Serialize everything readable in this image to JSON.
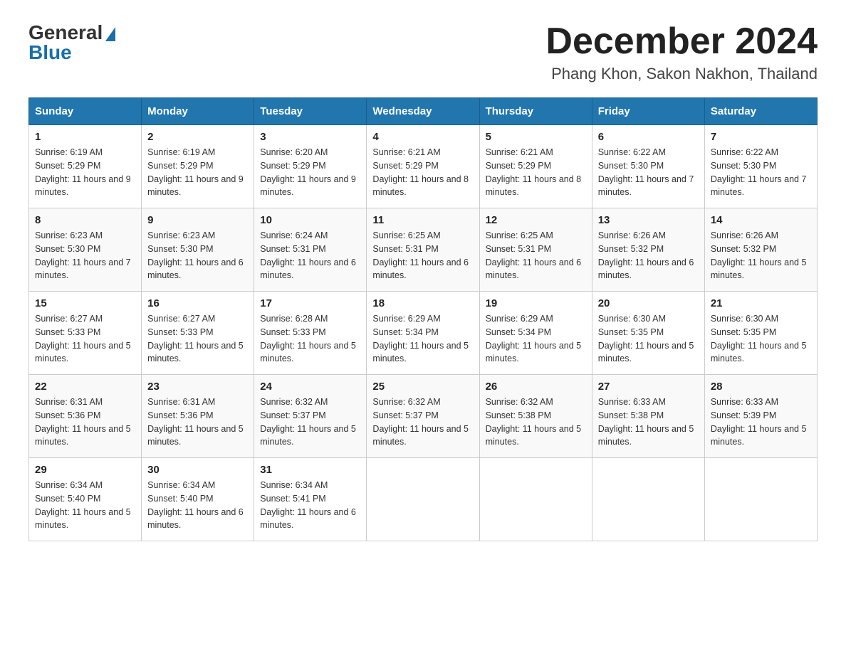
{
  "header": {
    "logo_general": "General",
    "logo_blue": "Blue",
    "month": "December 2024",
    "location": "Phang Khon, Sakon Nakhon, Thailand"
  },
  "days_of_week": [
    "Sunday",
    "Monday",
    "Tuesday",
    "Wednesday",
    "Thursday",
    "Friday",
    "Saturday"
  ],
  "weeks": [
    [
      {
        "day": "1",
        "sunrise": "6:19 AM",
        "sunset": "5:29 PM",
        "daylight": "11 hours and 9 minutes."
      },
      {
        "day": "2",
        "sunrise": "6:19 AM",
        "sunset": "5:29 PM",
        "daylight": "11 hours and 9 minutes."
      },
      {
        "day": "3",
        "sunrise": "6:20 AM",
        "sunset": "5:29 PM",
        "daylight": "11 hours and 9 minutes."
      },
      {
        "day": "4",
        "sunrise": "6:21 AM",
        "sunset": "5:29 PM",
        "daylight": "11 hours and 8 minutes."
      },
      {
        "day": "5",
        "sunrise": "6:21 AM",
        "sunset": "5:29 PM",
        "daylight": "11 hours and 8 minutes."
      },
      {
        "day": "6",
        "sunrise": "6:22 AM",
        "sunset": "5:30 PM",
        "daylight": "11 hours and 7 minutes."
      },
      {
        "day": "7",
        "sunrise": "6:22 AM",
        "sunset": "5:30 PM",
        "daylight": "11 hours and 7 minutes."
      }
    ],
    [
      {
        "day": "8",
        "sunrise": "6:23 AM",
        "sunset": "5:30 PM",
        "daylight": "11 hours and 7 minutes."
      },
      {
        "day": "9",
        "sunrise": "6:23 AM",
        "sunset": "5:30 PM",
        "daylight": "11 hours and 6 minutes."
      },
      {
        "day": "10",
        "sunrise": "6:24 AM",
        "sunset": "5:31 PM",
        "daylight": "11 hours and 6 minutes."
      },
      {
        "day": "11",
        "sunrise": "6:25 AM",
        "sunset": "5:31 PM",
        "daylight": "11 hours and 6 minutes."
      },
      {
        "day": "12",
        "sunrise": "6:25 AM",
        "sunset": "5:31 PM",
        "daylight": "11 hours and 6 minutes."
      },
      {
        "day": "13",
        "sunrise": "6:26 AM",
        "sunset": "5:32 PM",
        "daylight": "11 hours and 6 minutes."
      },
      {
        "day": "14",
        "sunrise": "6:26 AM",
        "sunset": "5:32 PM",
        "daylight": "11 hours and 5 minutes."
      }
    ],
    [
      {
        "day": "15",
        "sunrise": "6:27 AM",
        "sunset": "5:33 PM",
        "daylight": "11 hours and 5 minutes."
      },
      {
        "day": "16",
        "sunrise": "6:27 AM",
        "sunset": "5:33 PM",
        "daylight": "11 hours and 5 minutes."
      },
      {
        "day": "17",
        "sunrise": "6:28 AM",
        "sunset": "5:33 PM",
        "daylight": "11 hours and 5 minutes."
      },
      {
        "day": "18",
        "sunrise": "6:29 AM",
        "sunset": "5:34 PM",
        "daylight": "11 hours and 5 minutes."
      },
      {
        "day": "19",
        "sunrise": "6:29 AM",
        "sunset": "5:34 PM",
        "daylight": "11 hours and 5 minutes."
      },
      {
        "day": "20",
        "sunrise": "6:30 AM",
        "sunset": "5:35 PM",
        "daylight": "11 hours and 5 minutes."
      },
      {
        "day": "21",
        "sunrise": "6:30 AM",
        "sunset": "5:35 PM",
        "daylight": "11 hours and 5 minutes."
      }
    ],
    [
      {
        "day": "22",
        "sunrise": "6:31 AM",
        "sunset": "5:36 PM",
        "daylight": "11 hours and 5 minutes."
      },
      {
        "day": "23",
        "sunrise": "6:31 AM",
        "sunset": "5:36 PM",
        "daylight": "11 hours and 5 minutes."
      },
      {
        "day": "24",
        "sunrise": "6:32 AM",
        "sunset": "5:37 PM",
        "daylight": "11 hours and 5 minutes."
      },
      {
        "day": "25",
        "sunrise": "6:32 AM",
        "sunset": "5:37 PM",
        "daylight": "11 hours and 5 minutes."
      },
      {
        "day": "26",
        "sunrise": "6:32 AM",
        "sunset": "5:38 PM",
        "daylight": "11 hours and 5 minutes."
      },
      {
        "day": "27",
        "sunrise": "6:33 AM",
        "sunset": "5:38 PM",
        "daylight": "11 hours and 5 minutes."
      },
      {
        "day": "28",
        "sunrise": "6:33 AM",
        "sunset": "5:39 PM",
        "daylight": "11 hours and 5 minutes."
      }
    ],
    [
      {
        "day": "29",
        "sunrise": "6:34 AM",
        "sunset": "5:40 PM",
        "daylight": "11 hours and 5 minutes."
      },
      {
        "day": "30",
        "sunrise": "6:34 AM",
        "sunset": "5:40 PM",
        "daylight": "11 hours and 6 minutes."
      },
      {
        "day": "31",
        "sunrise": "6:34 AM",
        "sunset": "5:41 PM",
        "daylight": "11 hours and 6 minutes."
      },
      null,
      null,
      null,
      null
    ]
  ],
  "labels": {
    "sunrise": "Sunrise:",
    "sunset": "Sunset:",
    "daylight": "Daylight:"
  }
}
